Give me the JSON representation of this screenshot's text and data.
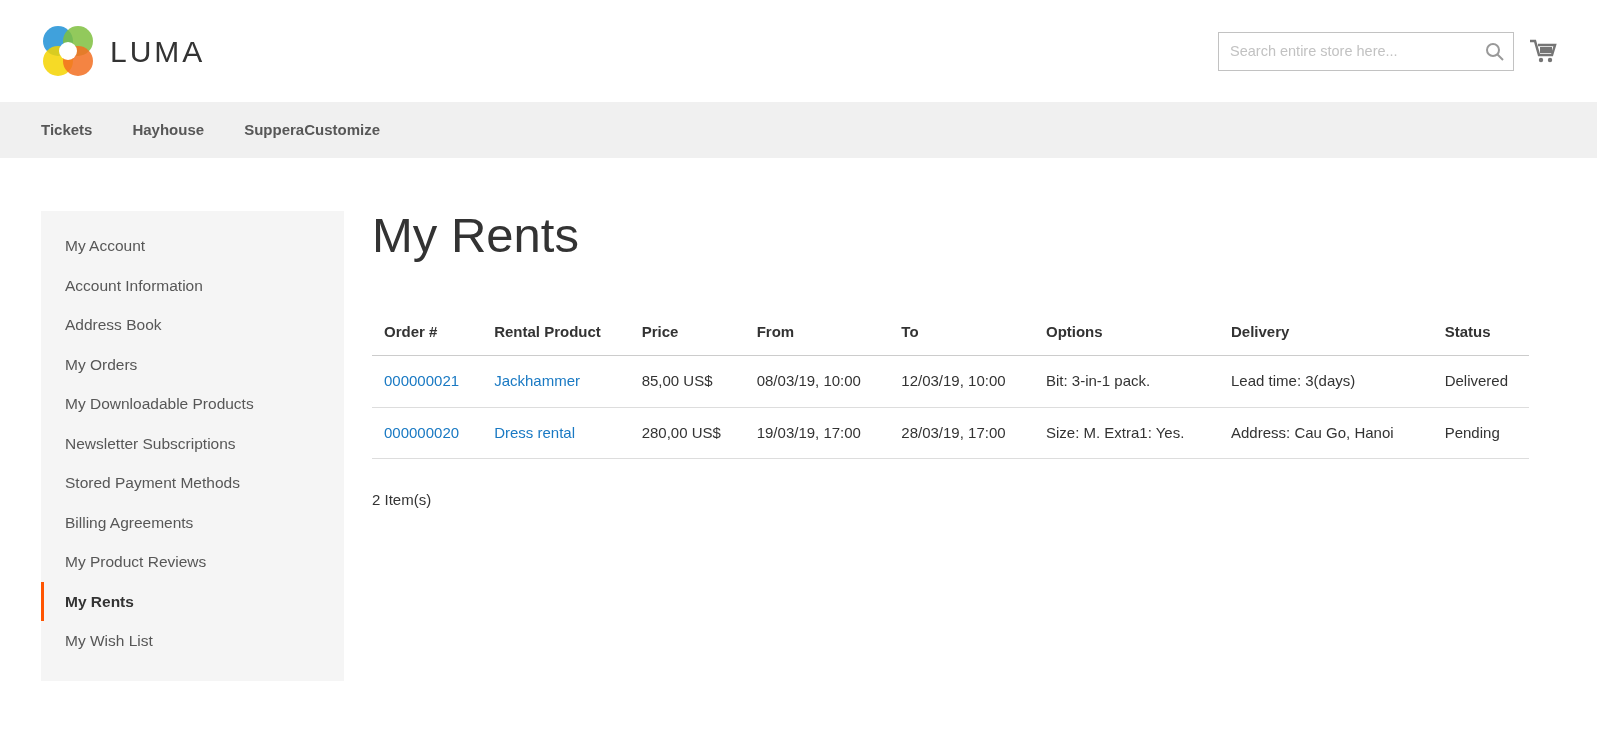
{
  "header": {
    "logo_text": "LUMA",
    "search": {
      "placeholder": "Search entire store here..."
    }
  },
  "nav": [
    {
      "label": "Tickets"
    },
    {
      "label": "Hayhouse"
    },
    {
      "label": "SupperaCustomize"
    }
  ],
  "sidebar": {
    "items": [
      {
        "label": "My Account",
        "selected": false
      },
      {
        "label": "Account Information",
        "selected": false
      },
      {
        "label": "Address Book",
        "selected": false
      },
      {
        "label": "My Orders",
        "selected": false
      },
      {
        "label": "My Downloadable Products",
        "selected": false
      },
      {
        "label": "Newsletter Subscriptions",
        "selected": false
      },
      {
        "label": "Stored Payment Methods",
        "selected": false
      },
      {
        "label": "Billing Agreements",
        "selected": false
      },
      {
        "label": "My Product Reviews",
        "selected": false
      },
      {
        "label": "My Rents",
        "selected": true
      },
      {
        "label": "My Wish List",
        "selected": false
      }
    ]
  },
  "page_title": "My Rents",
  "table": {
    "columns": [
      "Order #",
      "Rental Product",
      "Price",
      "From",
      "To",
      "Options",
      "Delivery",
      "Status"
    ],
    "rows": [
      [
        "000000021",
        "Jackhammer",
        "85,00 US$",
        "08/03/19, 10:00",
        "12/03/19, 10:00",
        "Bit: 3-in-1 pack.",
        "Lead time: 3(days)",
        "Delivered"
      ],
      [
        "000000020",
        "Dress rental",
        "280,00 US$",
        "19/03/19, 17:00",
        "28/03/19, 17:00",
        "Size: M. Extra1: Yes.",
        "Address: Cau Go, Hanoi",
        "Pending"
      ]
    ]
  },
  "item_count": "2 Item(s)"
}
